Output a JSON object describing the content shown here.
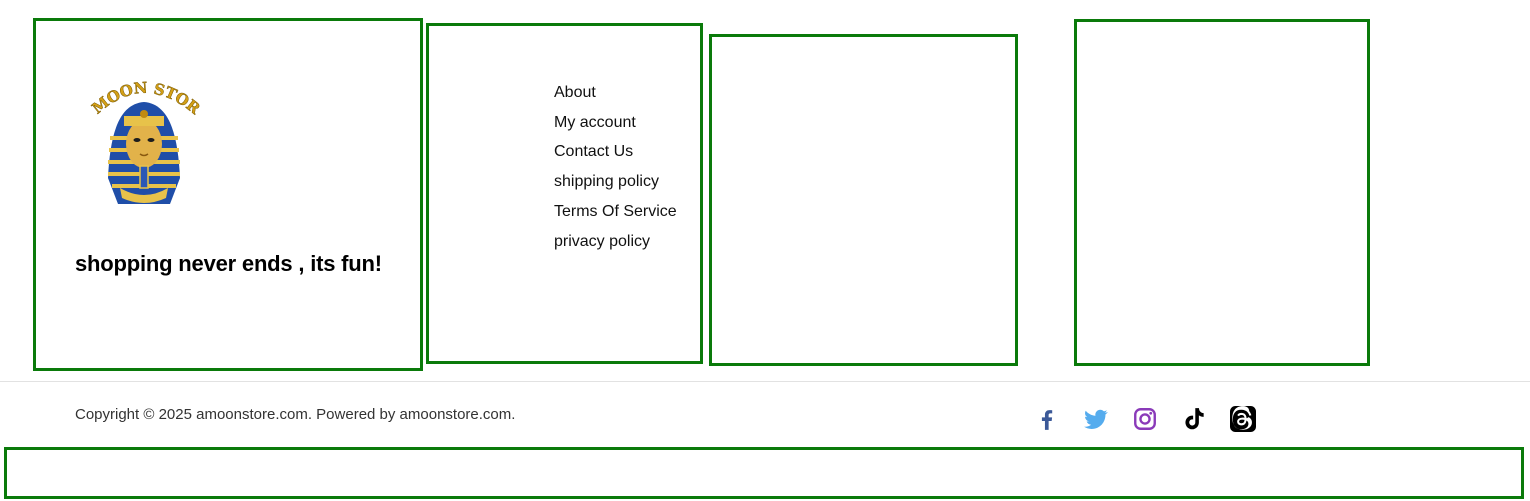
{
  "brand": {
    "logo_text": "AMOON STORE",
    "tagline": "shopping never ends , its fun!"
  },
  "footer_links": [
    {
      "label": "About"
    },
    {
      "label": "My account"
    },
    {
      "label": "Contact Us"
    },
    {
      "label": "shipping policy"
    },
    {
      "label": "Terms Of Service"
    },
    {
      "label": "privacy policy"
    }
  ],
  "copyright": "Copyright © 2025 amoonstore.com. Powered by amoonstore.com.",
  "social": [
    {
      "icon": "facebook-icon",
      "color": "#3b5998"
    },
    {
      "icon": "twitter-icon",
      "color": "#55acee"
    },
    {
      "icon": "instagram-icon",
      "color": "#8a3ab9"
    },
    {
      "icon": "tiktok-icon",
      "color": "#000000"
    },
    {
      "icon": "threads-icon",
      "color": "#000000"
    }
  ],
  "colors": {
    "outline": "#0a7a0a",
    "divider": "#e2e2e2"
  }
}
